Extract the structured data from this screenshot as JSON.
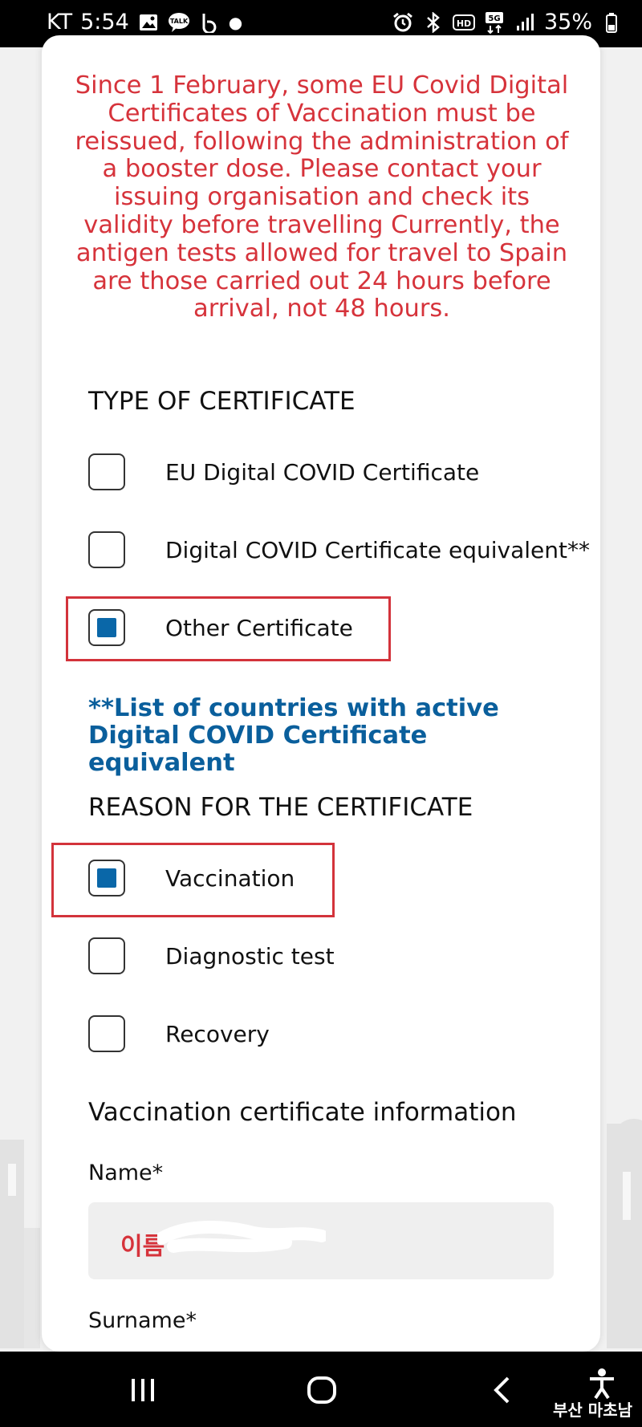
{
  "status_bar": {
    "carrier": "KT",
    "time": "5:54",
    "talk_badge": "TALK",
    "network": "5G",
    "hd_badge": "HD",
    "battery": "35%"
  },
  "notice_text": "Since 1 February, some EU Covid Digital Certificates of Vaccination must be reissued, following the administration of a booster dose. Please contact your issuing organisation and check its validity before travelling Currently, the antigen tests allowed for travel to Spain are those carried out 24 hours before arrival, not 48 hours.",
  "certificate_type": {
    "title": "TYPE OF CERTIFICATE",
    "options": [
      {
        "label": "EU Digital COVID Certificate",
        "checked": false
      },
      {
        "label": "Digital COVID Certificate equivalent**",
        "checked": false
      },
      {
        "label": "Other Certificate",
        "checked": true
      }
    ]
  },
  "equivalent_link": "**List of countries with active Digital COVID Certificate equivalent",
  "reason": {
    "title": "REASON FOR THE CERTIFICATE",
    "options": [
      {
        "label": "Vaccination",
        "checked": true
      },
      {
        "label": "Diagnostic test",
        "checked": false
      },
      {
        "label": "Recovery",
        "checked": false
      }
    ]
  },
  "vaccination_info": {
    "title": "Vaccination certificate information",
    "name_label": "Name*",
    "name_value": "이름",
    "surname_label": "Surname*"
  },
  "watermark": "부산 마초남",
  "colors": {
    "notice_red": "#d6333b",
    "link_blue": "#0a5f9c",
    "checkbox_fill": "#0a67a8",
    "highlight_red": "#d3333b"
  }
}
